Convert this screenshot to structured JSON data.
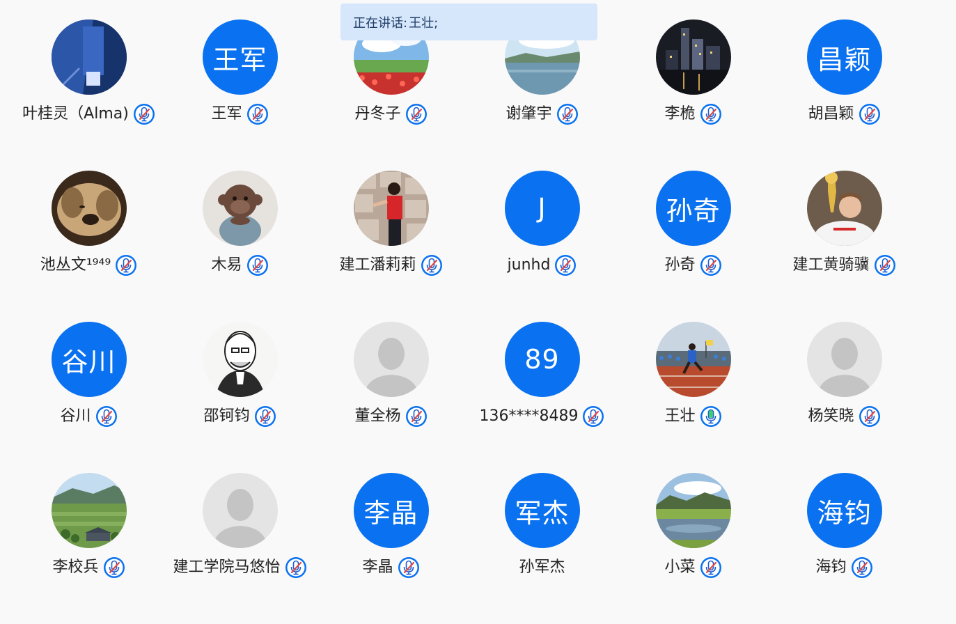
{
  "toast": {
    "label": "正在讲话:",
    "speaker": "王壮;"
  },
  "participants": [
    {
      "name": "叶桂灵（Alma)",
      "avatar": {
        "type": "photo",
        "subject": "blue-building-photo"
      },
      "mic": "muted"
    },
    {
      "name": "王军",
      "avatar": {
        "type": "text",
        "text": "王军"
      },
      "mic": "muted"
    },
    {
      "name": "丹冬子",
      "avatar": {
        "type": "photo",
        "subject": "flower-field-sky-photo"
      },
      "mic": "muted"
    },
    {
      "name": "谢肇宇",
      "avatar": {
        "type": "photo",
        "subject": "lake-landscape-photo"
      },
      "mic": "muted"
    },
    {
      "name": "李桅",
      "avatar": {
        "type": "photo",
        "subject": "city-night-photo"
      },
      "mic": "muted"
    },
    {
      "name": "胡昌颖",
      "avatar": {
        "type": "text",
        "text": "昌颖"
      },
      "mic": "muted"
    },
    {
      "name": "池丛文¹⁹⁴⁹",
      "avatar": {
        "type": "photo",
        "subject": "puppy-photo"
      },
      "mic": "muted"
    },
    {
      "name": "木易",
      "avatar": {
        "type": "photo",
        "subject": "monkey-figurine-photo"
      },
      "mic": "muted"
    },
    {
      "name": "建工潘莉莉",
      "avatar": {
        "type": "photo",
        "subject": "woman-stone-wall-photo"
      },
      "mic": "muted"
    },
    {
      "name": "junhd",
      "avatar": {
        "type": "text",
        "text": "J"
      },
      "mic": "muted"
    },
    {
      "name": "孙奇",
      "avatar": {
        "type": "text",
        "text": "孙奇"
      },
      "mic": "muted"
    },
    {
      "name": "建工黄骑骥",
      "avatar": {
        "type": "photo",
        "subject": "football-trophy-photo"
      },
      "mic": "muted"
    },
    {
      "name": "谷川",
      "avatar": {
        "type": "text",
        "text": "谷川"
      },
      "mic": "muted"
    },
    {
      "name": "邵钶钧",
      "avatar": {
        "type": "photo",
        "subject": "old-man-sketch"
      },
      "mic": "muted"
    },
    {
      "name": "董全杨",
      "avatar": {
        "type": "placeholder",
        "subject": "default-person-avatar"
      },
      "mic": "muted"
    },
    {
      "name": "136****8489",
      "avatar": {
        "type": "text",
        "text": "89"
      },
      "mic": "muted"
    },
    {
      "name": "王壮",
      "avatar": {
        "type": "photo",
        "subject": "runner-track-photo"
      },
      "mic": "speaking"
    },
    {
      "name": "杨笑晓",
      "avatar": {
        "type": "placeholder",
        "subject": "default-person-avatar"
      },
      "mic": "muted"
    },
    {
      "name": "李校兵",
      "avatar": {
        "type": "photo",
        "subject": "green-village-photo"
      },
      "mic": "muted"
    },
    {
      "name": "建工学院马悠怡",
      "avatar": {
        "type": "placeholder",
        "subject": "default-person-avatar"
      },
      "mic": "muted"
    },
    {
      "name": "李晶",
      "avatar": {
        "type": "text",
        "text": "李晶"
      },
      "mic": "muted"
    },
    {
      "name": "孙军杰",
      "avatar": {
        "type": "text",
        "text": "军杰"
      },
      "mic": "none"
    },
    {
      "name": "小菜",
      "avatar": {
        "type": "photo",
        "subject": "park-pond-photo"
      },
      "mic": "muted"
    },
    {
      "name": "海钧",
      "avatar": {
        "type": "text",
        "text": "海钧"
      },
      "mic": "muted"
    }
  ],
  "colors": {
    "accent": "#0a72f0",
    "toast_bg": "#d6e6fb",
    "muted_slash": "#e04848",
    "speaking": "#3ecf6a"
  }
}
